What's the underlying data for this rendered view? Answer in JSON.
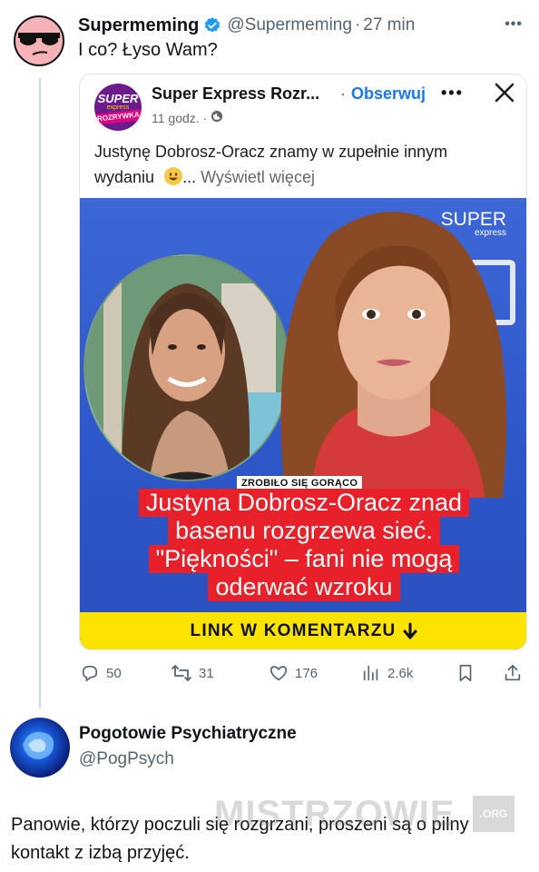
{
  "tweet1": {
    "author_name": "Supermeming",
    "handle": "@Supermeming",
    "separator": "·",
    "time": "27 min",
    "text": "I co? Łyso Wam?"
  },
  "embed": {
    "page_name": "Super Express Rozr...",
    "dot": "·",
    "follow_label": "Obserwuj",
    "more_label": "•••",
    "meta_time": "11 godz.",
    "meta_dot": "·",
    "logo_line1": "SUPER",
    "logo_line2": "express",
    "logo_line3": "ROZRYWKA",
    "text_line1": "Justynę Dobrosz-Oracz znamy w zupełnie innym",
    "text_line2": "wydaniu",
    "ellipsis": "...",
    "see_more": "Wyświetl więcej",
    "image": {
      "brand": "SUPER",
      "brand_sub": "express",
      "tag": "ZROBIŁO SIĘ GORĄCO",
      "headline_lines": [
        "Justyna Dobrosz-Oracz znad",
        "basenu rozgrzewa sieć.",
        "\"Piękności\" – fani nie mogą",
        "oderwać wzroku"
      ],
      "cta": "LINK W KOMENTARZU"
    }
  },
  "actions": {
    "replies": "50",
    "retweets": "31",
    "likes": "176",
    "views": "2.6k"
  },
  "tweet2": {
    "author_name": "Pogotowie Psychiatryczne",
    "handle": "@PogPsych",
    "text": "Panowie, którzy poczuli się rozgrzani, proszeni są o pilny kontakt z izbą przyjęć."
  },
  "watermark": {
    "text": "MISTRZOWIE",
    "suffix": ".ORG"
  },
  "colors": {
    "twitter_blue": "#1d9bf0",
    "fb_blue": "#1877f2",
    "headline_red": "#e8202a",
    "cta_yellow": "#fce300",
    "muted": "#536471"
  }
}
